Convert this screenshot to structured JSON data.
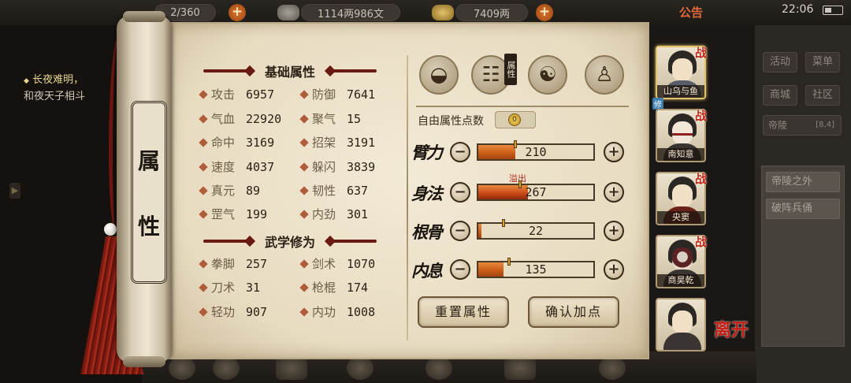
{
  "topbar": {
    "stamina": "2/360",
    "coins": "1114两986文",
    "gold": "7409两",
    "notice": "公告",
    "time": "22:06"
  },
  "quest": {
    "title": "长夜难明，",
    "sub": "和夜天子相斗"
  },
  "right_panel": {
    "buttons": [
      "活动",
      "菜单",
      "商城",
      "社区"
    ],
    "location": {
      "name": "帝陵",
      "pos": "[8,4]"
    },
    "list": [
      "帝陵之外",
      "破阵兵俑"
    ]
  },
  "scroll_title": [
    "属",
    "性"
  ],
  "sections": {
    "basic": "基础属性",
    "martial": "武学修为"
  },
  "basic_stats": [
    {
      "label": "攻击",
      "value": "6957"
    },
    {
      "label": "防御",
      "value": "7641"
    },
    {
      "label": "气血",
      "value": "22920"
    },
    {
      "label": "聚气",
      "value": "15"
    },
    {
      "label": "命中",
      "value": "3169"
    },
    {
      "label": "招架",
      "value": "3191"
    },
    {
      "label": "速度",
      "value": "4037"
    },
    {
      "label": "躲闪",
      "value": "3839"
    },
    {
      "label": "真元",
      "value": "89"
    },
    {
      "label": "韧性",
      "value": "637"
    },
    {
      "label": "罡气",
      "value": "199"
    },
    {
      "label": "内劲",
      "value": "301"
    }
  ],
  "martial_stats": [
    {
      "label": "拳脚",
      "value": "257"
    },
    {
      "label": "剑术",
      "value": "1070"
    },
    {
      "label": "刀术",
      "value": "31"
    },
    {
      "label": "枪棍",
      "value": "174"
    },
    {
      "label": "轻功",
      "value": "907"
    },
    {
      "label": "内功",
      "value": "1008"
    }
  ],
  "tabs": {
    "badge": "属性",
    "icons": [
      "character-hat-icon",
      "scroll-attribute-icon",
      "yinyang-icon",
      "body-meridian-icon"
    ]
  },
  "free_points": {
    "label": "自由属性点数",
    "value": "0"
  },
  "attributes": [
    {
      "name": "臂力",
      "value": "210",
      "fill": 0.32,
      "mark": 0.32,
      "overflow": false
    },
    {
      "name": "身法",
      "value": "267",
      "fill": 0.43,
      "mark": 0.36,
      "overflow": true
    },
    {
      "name": "根骨",
      "value": "22",
      "fill": 0.03,
      "mark": 0.22,
      "overflow": false
    },
    {
      "name": "内息",
      "value": "135",
      "fill": 0.22,
      "mark": 0.27,
      "overflow": false
    }
  ],
  "overflow_label": "溢出",
  "actions": {
    "reset": "重置属性",
    "confirm": "确认加点"
  },
  "party": [
    {
      "name": "山乌与鱼",
      "battle": "战",
      "selected": true,
      "tag": "修"
    },
    {
      "name": "南知意",
      "battle": "战",
      "selected": false
    },
    {
      "name": "央窦",
      "battle": "战",
      "selected": false
    },
    {
      "name": "商昊乾",
      "battle": "战",
      "selected": false
    },
    {
      "name": "",
      "battle": "",
      "selected": false
    }
  ],
  "leave_label": "离开",
  "colors": {
    "accent": "#c85a16",
    "battle_red": "#c02818",
    "paper": "#efe6d3",
    "ink": "#2a1e12"
  }
}
